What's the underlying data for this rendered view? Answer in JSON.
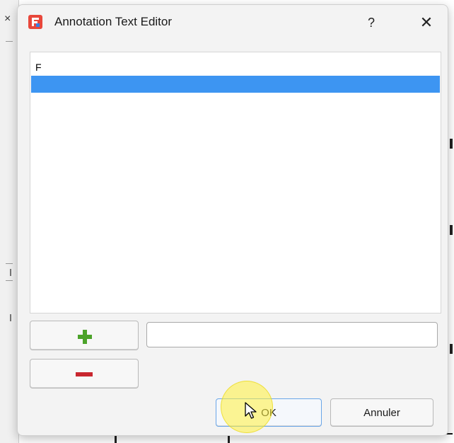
{
  "dialog": {
    "title": "Annotation Text Editor",
    "help_label": "?",
    "close_label": "✕"
  },
  "background": {
    "close_label": "×"
  },
  "text_list": {
    "items": [
      {
        "text": "F",
        "selected": false
      },
      {
        "text": "",
        "selected": true
      }
    ]
  },
  "add_button": {
    "icon": "plus-icon",
    "color": "#4ca32a"
  },
  "remove_button": {
    "icon": "minus-icon",
    "color": "#c8272f"
  },
  "entry": {
    "value": "",
    "placeholder": ""
  },
  "buttons": {
    "ok_label": "OK",
    "cancel_label": "Annuler"
  },
  "colors": {
    "selection": "#3d95f2",
    "app_icon_red": "#e8473b",
    "app_icon_blue": "#3b7fe0"
  }
}
